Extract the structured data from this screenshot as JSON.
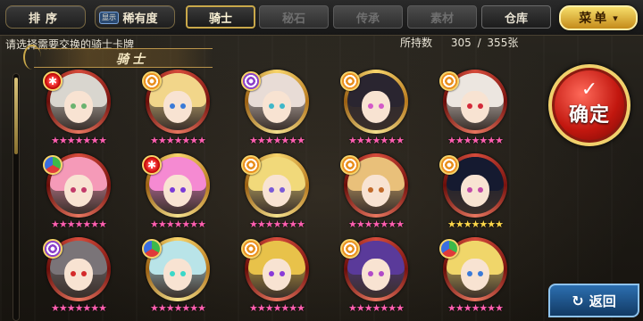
{
  "toolbar": {
    "sort_label": "排序",
    "display_tag": "显示",
    "rarity_label": "稀有度",
    "menu_label": "菜单",
    "menu_icon": "▾"
  },
  "tabs": [
    {
      "label": "骑士",
      "state": "active"
    },
    {
      "label": "秘石",
      "state": "inactive"
    },
    {
      "label": "传承",
      "state": "inactive"
    },
    {
      "label": "素材",
      "state": "inactive"
    },
    {
      "label": "仓库",
      "state": "dim"
    }
  ],
  "header": {
    "prompt": "请选择需要交换的骑士卡牌",
    "holding_label": "所持数",
    "holding_value": "305 / 355张",
    "category_title": "骑士"
  },
  "scroll": {
    "position": 0.0,
    "visible_fraction": 0.31
  },
  "cards": [
    {
      "emblem": "star",
      "ring": "red",
      "hair": "#d9d6cf",
      "eye": "#6bb36f",
      "stars": "★★★★★★★",
      "star_color": "pink"
    },
    {
      "emblem": "spiral",
      "ring": "red",
      "hair": "#f2d68a",
      "eye": "#3a7ad8",
      "stars": "★★★★★★★",
      "star_color": "pink"
    },
    {
      "emblem": "purple",
      "ring": "gold",
      "hair": "#e8dcd6",
      "eye": "#3fb7c9",
      "stars": "★★★★★★★",
      "star_color": "pink"
    },
    {
      "emblem": "spiral",
      "ring": "gold",
      "hair": "#2a2530",
      "eye": "#d45ac8",
      "stars": "★★★★★★★",
      "star_color": "pink"
    },
    {
      "emblem": "spiral",
      "ring": "red",
      "hair": "#ece6e0",
      "eye": "#d42a3a",
      "stars": "★★★★★★★",
      "star_color": "pink"
    },
    {
      "emblem": "green",
      "ring": "red",
      "hair": "#f59ab8",
      "eye": "#c23a6a",
      "stars": "★★★★★★★",
      "star_color": "pink"
    },
    {
      "emblem": "star",
      "ring": "gold",
      "hair": "#f58ad2",
      "eye": "#7a3ad8",
      "stars": "★★★★★★★",
      "star_color": "pink"
    },
    {
      "emblem": "spiral",
      "ring": "gold",
      "hair": "#f1d97a",
      "eye": "#7a5ad8",
      "stars": "★★★★★★★",
      "star_color": "pink"
    },
    {
      "emblem": "spiral",
      "ring": "red",
      "hair": "#e9c07a",
      "eye": "#c26a2a",
      "stars": "★★★★★★★",
      "star_color": "pink"
    },
    {
      "emblem": "spiral",
      "ring": "red",
      "hair": "#151a30",
      "eye": "#c24aa8",
      "stars": "★★★★★★★",
      "star_color": "gold"
    },
    {
      "emblem": "purple",
      "ring": "red",
      "hair": "#7a7478",
      "eye": "#d42a2a",
      "stars": "★★★★★★★",
      "star_color": "pink"
    },
    {
      "emblem": "green",
      "ring": "gold",
      "hair": "#b9e4e8",
      "eye": "#3ad8c8",
      "stars": "★★★★★★★",
      "star_color": "pink"
    },
    {
      "emblem": "spiral",
      "ring": "red",
      "hair": "#e8c24a",
      "eye": "#8a3ad8",
      "stars": "★★★★★★★",
      "star_color": "pink"
    },
    {
      "emblem": "spiral",
      "ring": "red",
      "hair": "#5a3a9a",
      "eye": "#b04ac8",
      "stars": "★★★★★★★",
      "star_color": "pink"
    },
    {
      "emblem": "green",
      "ring": "red",
      "hair": "#f0d66a",
      "eye": "#3a7ad8",
      "stars": "★★★★★★★",
      "star_color": "pink"
    }
  ],
  "actions": {
    "confirm_label": "确定",
    "confirm_icon": "✓",
    "back_label": "返回",
    "back_icon": "↻"
  }
}
